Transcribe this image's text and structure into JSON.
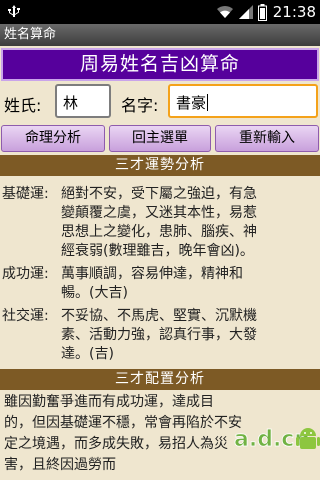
{
  "status_bar": {
    "time": "21:38",
    "icons": [
      "usb-icon",
      "wifi-icon",
      "signal-icon",
      "battery-icon"
    ]
  },
  "app": {
    "title": "姓名算命"
  },
  "banner": {
    "text": "周易姓名吉凶算命"
  },
  "form": {
    "surname_label": "姓氏:",
    "surname_value": "林",
    "name_label": "名字:",
    "name_value": "書豪"
  },
  "buttons": {
    "analyze": "命理分析",
    "home": "回主選單",
    "reenter": "重新輸入"
  },
  "sections": {
    "fortune_title": "三才運勢分析",
    "config_title": "三才配置分析"
  },
  "fortune": {
    "base_label": "基礎運:",
    "base_lines": [
      "絕對不安，受下屬之強迫，有急",
      "變顛覆之虞，又迷其本性，易惹",
      "思想上之變化，患肺、腦疾、神",
      "經衰弱(數理雖吉，晚年會凶)。"
    ],
    "success_label": "成功運:",
    "success_lines": [
      "萬事順調，容易伸達，精神和",
      "暢。(大吉)"
    ],
    "social_label": "社交運:",
    "social_lines": [
      "不妥協、不馬虎、堅實、沉默機",
      "素、活動力強，認真行事，大發",
      "達。(吉)"
    ]
  },
  "config": {
    "lines": [
      "雖因勤奮爭進而有成功運，達成目",
      "的，但因基礎運不穩，常會再陷於不安",
      "定之境遇，而多成失敗，易招人為災",
      "害，且終因過勞而"
    ]
  },
  "watermark": {
    "text": "a.d.cn"
  },
  "colors": {
    "banner": "#56009c",
    "section": "#7d5a25",
    "button": "#d9bce8",
    "background": "#efe6cf"
  }
}
